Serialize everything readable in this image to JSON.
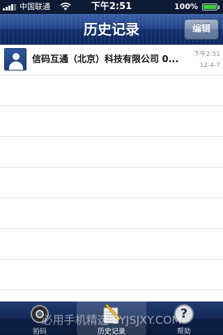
{
  "status_bar": {
    "carrier": "中国联通",
    "time": "下午2:51",
    "battery_percent": "100%",
    "battery_color": "#3ad03a"
  },
  "nav": {
    "title": "历史记录",
    "edit_label": "编辑"
  },
  "history": {
    "items": [
      {
        "title": "信码互通（北京）科技有限公司 0...",
        "time": "下午2:51",
        "date": "12-4-7",
        "icon": "contact-card-icon"
      }
    ]
  },
  "tabbar": {
    "tabs": [
      {
        "label": "拍码",
        "icon": "camera-scan-icon",
        "selected": false
      },
      {
        "label": "历史记录",
        "icon": "notepad-pencil-icon",
        "selected": true
      },
      {
        "label": "帮助",
        "icon": "help-icon",
        "selected": false
      }
    ]
  },
  "watermark": "必用手机精选 BYJSJXY.COM",
  "colors": {
    "nav_dark": "#0e2760",
    "nav_light": "#3c62a8",
    "separator": "#e0e0e0"
  }
}
